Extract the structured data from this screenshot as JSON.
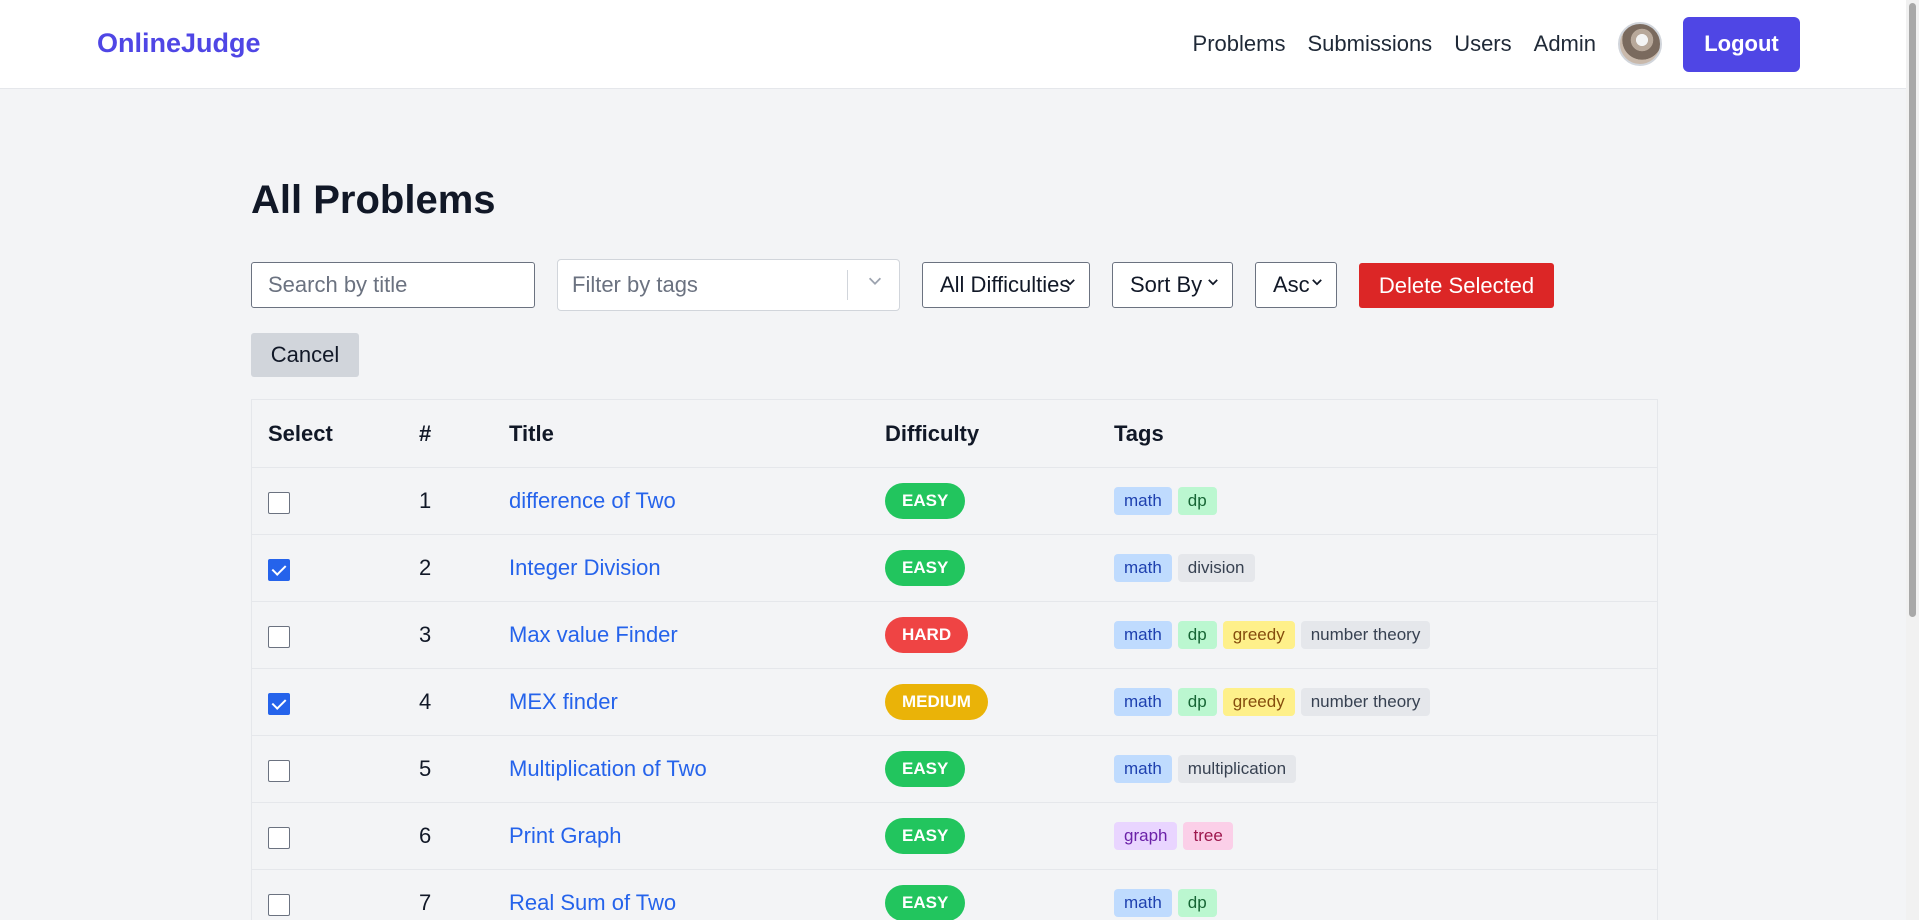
{
  "nav": {
    "brand": "OnlineJudge",
    "links": [
      "Problems",
      "Submissions",
      "Users",
      "Admin"
    ],
    "logout": "Logout"
  },
  "page": {
    "title": "All Problems"
  },
  "filters": {
    "search_placeholder": "Search by title",
    "tags_placeholder": "Filter by tags",
    "difficulty": "All Difficulties",
    "sort_by": "Sort By",
    "order": "Asc",
    "delete_label": "Delete Selected",
    "cancel_label": "Cancel"
  },
  "table": {
    "headers": [
      "Select",
      "#",
      "Title",
      "Difficulty",
      "Tags"
    ],
    "rows": [
      {
        "checked": false,
        "num": "1",
        "title": "difference of Two",
        "difficulty": "EASY",
        "tags": [
          "math",
          "dp"
        ]
      },
      {
        "checked": true,
        "num": "2",
        "title": "Integer Division",
        "difficulty": "EASY",
        "tags": [
          "math",
          "division"
        ]
      },
      {
        "checked": false,
        "num": "3",
        "title": "Max value Finder",
        "difficulty": "HARD",
        "tags": [
          "math",
          "dp",
          "greedy",
          "number theory"
        ]
      },
      {
        "checked": true,
        "num": "4",
        "title": "MEX finder",
        "difficulty": "MEDIUM",
        "tags": [
          "math",
          "dp",
          "greedy",
          "number theory"
        ]
      },
      {
        "checked": false,
        "num": "5",
        "title": "Multiplication of Two",
        "difficulty": "EASY",
        "tags": [
          "math",
          "multiplication"
        ]
      },
      {
        "checked": false,
        "num": "6",
        "title": "Print Graph",
        "difficulty": "EASY",
        "tags": [
          "graph",
          "tree"
        ]
      },
      {
        "checked": false,
        "num": "7",
        "title": "Real Sum of Two",
        "difficulty": "EASY",
        "tags": [
          "math",
          "dp"
        ]
      }
    ]
  },
  "colors": {
    "brand": "#4f46e5",
    "danger": "#dc2626",
    "link": "#2563eb",
    "easy": "#22c55e",
    "medium": "#eab308",
    "hard": "#ef4444"
  }
}
